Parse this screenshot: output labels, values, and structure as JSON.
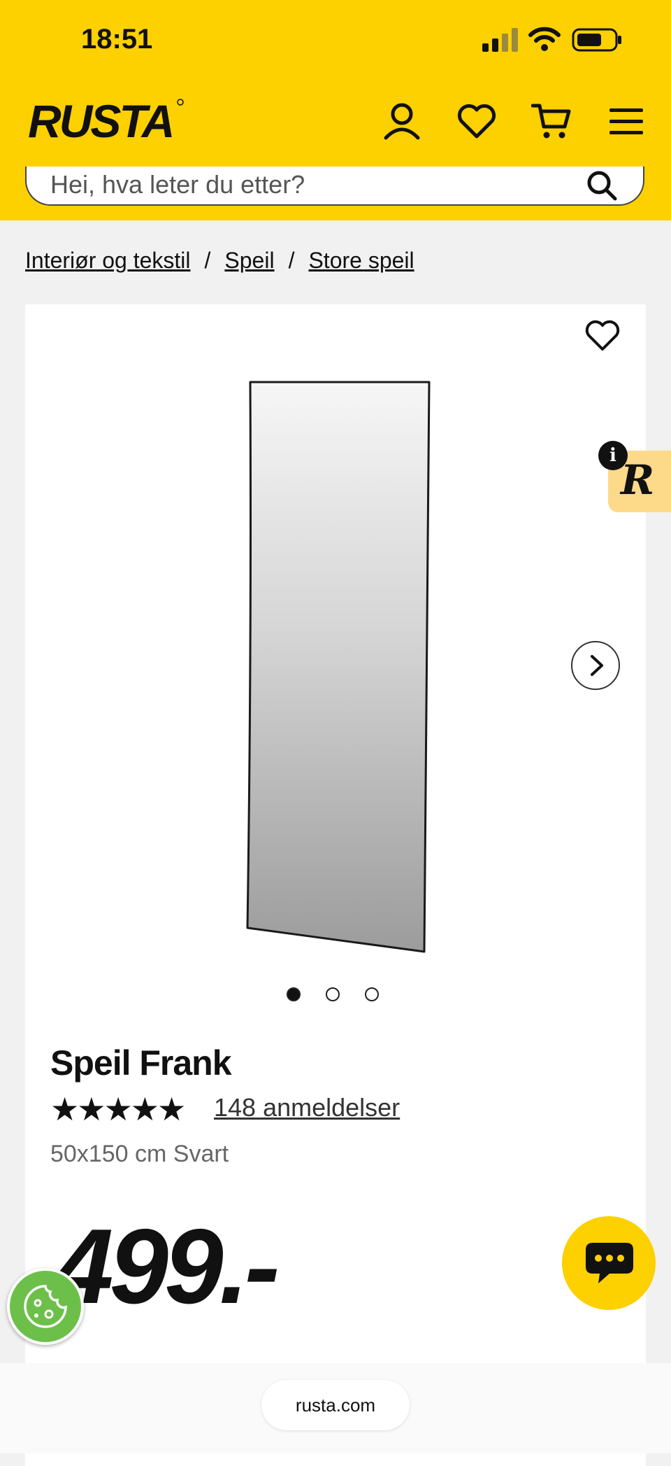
{
  "status_bar": {
    "time": "18:51"
  },
  "header": {
    "logo_text": "RUSTA",
    "icons": [
      "account-icon",
      "heart-icon",
      "cart-icon",
      "menu-icon"
    ],
    "search": {
      "placeholder": "Hei, hva leter du etter?"
    },
    "colors": {
      "brand_yellow": "#fdd000"
    }
  },
  "breadcrumb": {
    "items": [
      "Interiør og tekstil",
      "Speil",
      "Store speil"
    ],
    "separator": "/"
  },
  "product": {
    "title": "Speil Frank",
    "stars": "★★★★★",
    "reviews_label": "148 anmeldelser",
    "variant": "50x150 cm Svart",
    "price": "499.-",
    "image_count": 3,
    "active_image": 1
  },
  "widgets": {
    "badge_letter": "R",
    "info_label": "i"
  },
  "browser": {
    "url": "rusta.com"
  }
}
